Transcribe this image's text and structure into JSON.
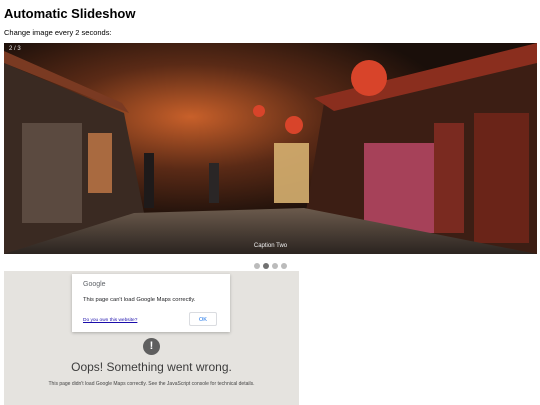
{
  "page": {
    "title": "Automatic Slideshow",
    "subtitle": "Change image every 2 seconds:"
  },
  "slideshow": {
    "number_text": "2 / 3",
    "caption": "Caption Two",
    "image_description": "Old town street at night with wooden buildings, red lanterns and shops",
    "dots_total": 4,
    "active_dot": 2
  },
  "map_error": {
    "dialog": {
      "logo": "Google",
      "message": "This page can't load Google Maps correctly.",
      "link_label": "Do you own this website?",
      "ok_label": "OK"
    },
    "icon_glyph": "!",
    "title": "Oops! Something went wrong.",
    "detail": "This page didn't load Google Maps correctly. See the JavaScript console for technical details."
  }
}
